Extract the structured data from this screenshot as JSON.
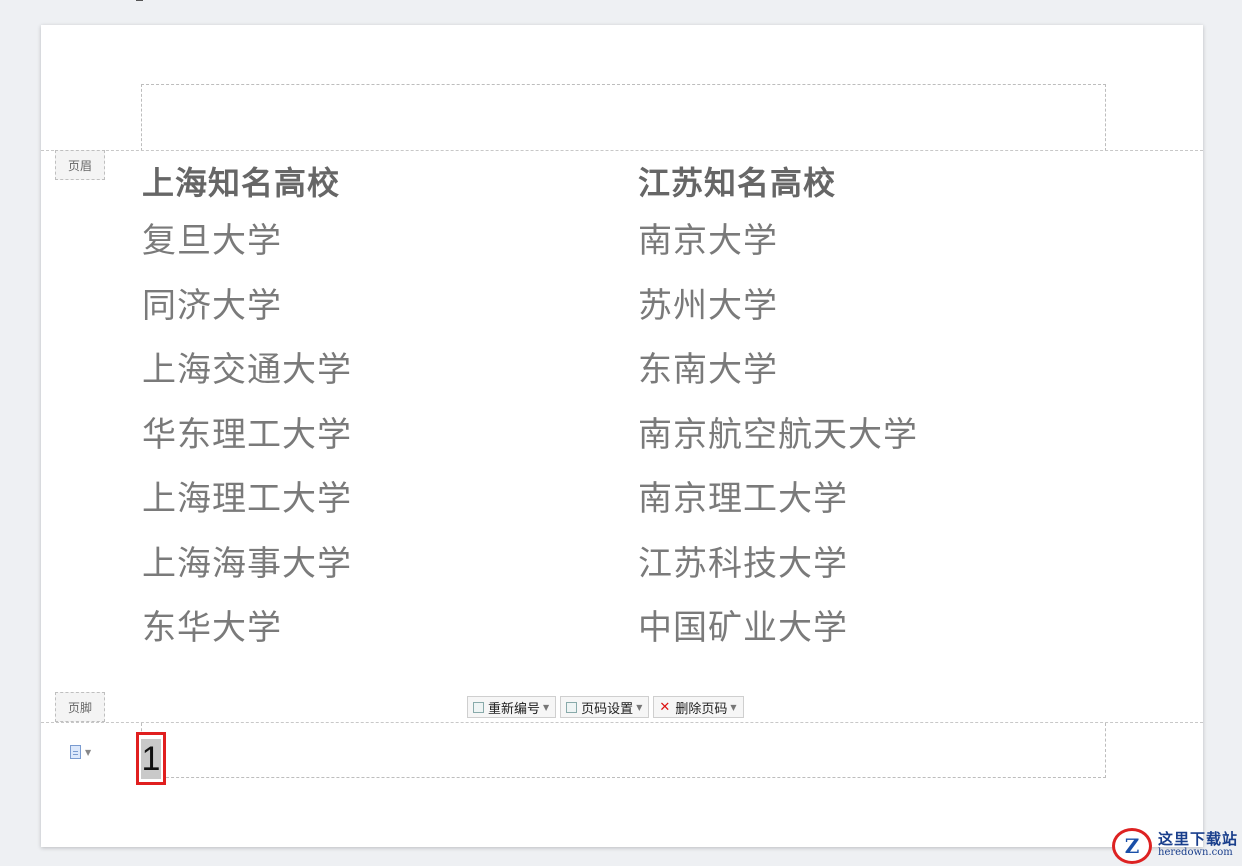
{
  "header": {
    "tag_label": "页眉"
  },
  "footer": {
    "tag_label": "页脚",
    "page_number": "1",
    "toolbar": {
      "renumber_label": "重新编号",
      "page_settings_label": "页码设置",
      "delete_label": "删除页码"
    }
  },
  "columns": {
    "left": {
      "title": "上海知名高校",
      "items": [
        "复旦大学",
        "同济大学",
        "上海交通大学",
        "华东理工大学",
        "上海理工大学",
        "上海海事大学",
        "东华大学"
      ]
    },
    "right": {
      "title": "江苏知名高校",
      "items": [
        "南京大学",
        "苏州大学",
        "东南大学",
        "南京航空航天大学",
        "南京理工大学",
        "江苏科技大学",
        "中国矿业大学"
      ]
    }
  },
  "watermark": {
    "title": "这里下载站",
    "url": "heredown.com",
    "logo_letter": "Z"
  },
  "colors": {
    "page_number_highlight": "#e01f1f",
    "delete_icon": "#dd1111"
  }
}
